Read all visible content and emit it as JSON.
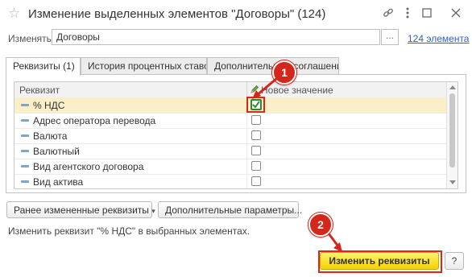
{
  "window": {
    "title": "Изменение выделенных элементов \"Договоры\" (124)",
    "icons": [
      "star-icon",
      "link-icon",
      "more-icon",
      "maximize-icon",
      "close-icon"
    ]
  },
  "change": {
    "label": "Изменять:",
    "value": "Договоры",
    "select_button": "...",
    "count_link": "124 элемента"
  },
  "tabs": [
    {
      "label": "Реквизиты (1)",
      "active": true
    },
    {
      "label": "История процентных ставок",
      "active": false
    },
    {
      "label": "Дополнительные соглашения",
      "active": false
    }
  ],
  "grid": {
    "col_requisite": "Реквизит",
    "col_new_value": "Новое значение",
    "rows": [
      {
        "label": "% НДС",
        "checked": true,
        "selected": true
      },
      {
        "label": "Адрес оператора перевода",
        "checked": false,
        "selected": false
      },
      {
        "label": "Валюта",
        "checked": false,
        "selected": false
      },
      {
        "label": "Валютный",
        "checked": false,
        "selected": false
      },
      {
        "label": "Вид агентского договора",
        "checked": false,
        "selected": false
      },
      {
        "label": "Вид актива",
        "checked": false,
        "selected": false
      }
    ]
  },
  "buttons": {
    "recent": "Ранее измененные реквизиты",
    "extra": "Дополнительные параметры...",
    "apply": "Изменить реквизиты",
    "help": "?"
  },
  "status_text": "Изменить реквизит \"% НДС\" в выбранных элементах.",
  "callouts": [
    "1",
    "2"
  ],
  "colors": {
    "accent_link": "#2d62c8",
    "primary_button": "#f4d400",
    "callout": "#d4261a",
    "selected_row": "#faefc8",
    "checkmark": "#2f8a2f"
  }
}
